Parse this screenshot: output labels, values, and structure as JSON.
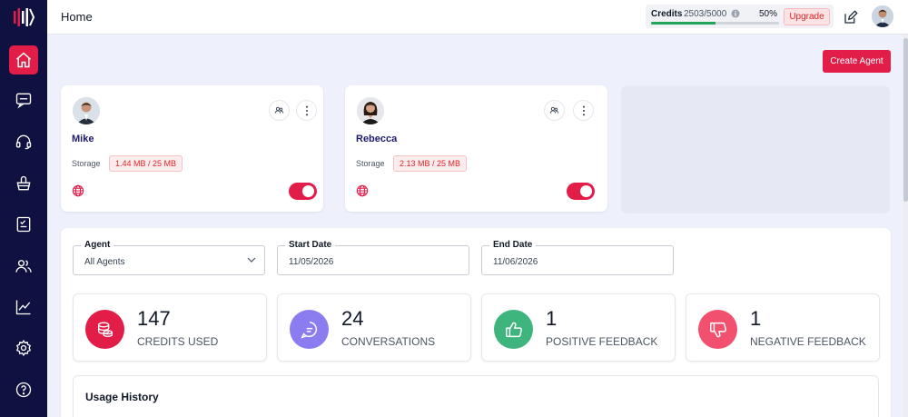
{
  "header": {
    "title": "Home"
  },
  "credits": {
    "label": "Credits",
    "value": "2503/5000",
    "percent_label": "50%",
    "percent": 0.5,
    "upgrade_label": "Upgrade"
  },
  "actions": {
    "create_agent_label": "Create Agent"
  },
  "sidebar": {
    "items": [
      {
        "icon": "home-icon",
        "active": true
      },
      {
        "icon": "chat-icon",
        "active": false
      },
      {
        "icon": "headset-icon",
        "active": false
      },
      {
        "icon": "basket-icon",
        "active": false
      },
      {
        "icon": "checklist-icon",
        "active": false
      },
      {
        "icon": "users-icon",
        "active": false
      },
      {
        "icon": "chart-icon",
        "active": false
      },
      {
        "icon": "gear-icon",
        "active": false
      },
      {
        "icon": "help-icon",
        "active": false
      }
    ]
  },
  "agents": [
    {
      "name": "Mike",
      "storage_label": "Storage",
      "storage": "1.44 MB / 25 MB",
      "enabled": true
    },
    {
      "name": "Rebecca",
      "storage_label": "Storage",
      "storage": "2.13 MB / 25 MB",
      "enabled": true
    }
  ],
  "filters": {
    "agent": {
      "label": "Agent",
      "value": "All Agents"
    },
    "start": {
      "label": "Start Date",
      "value": "11/05/2026"
    },
    "end": {
      "label": "End Date",
      "value": "11/06/2026"
    }
  },
  "stats": [
    {
      "value": "147",
      "label": "CREDITS USED",
      "icon": "coins-icon",
      "color": "#e11d48"
    },
    {
      "value": "24",
      "label": "CONVERSATIONS",
      "icon": "chat-bubble-icon",
      "color": "#8b7cf0"
    },
    {
      "value": "1",
      "label": "POSITIVE FEEDBACK",
      "icon": "thumbs-up-icon",
      "color": "#3db57c"
    },
    {
      "value": "1",
      "label": "NEGATIVE FEEDBACK",
      "icon": "thumbs-down-icon",
      "color": "#f2506f"
    }
  ],
  "usage": {
    "title": "Usage History"
  },
  "colors": {
    "sidebar": "#0f1240",
    "accent": "#e11d48",
    "background": "#eef1fb"
  }
}
